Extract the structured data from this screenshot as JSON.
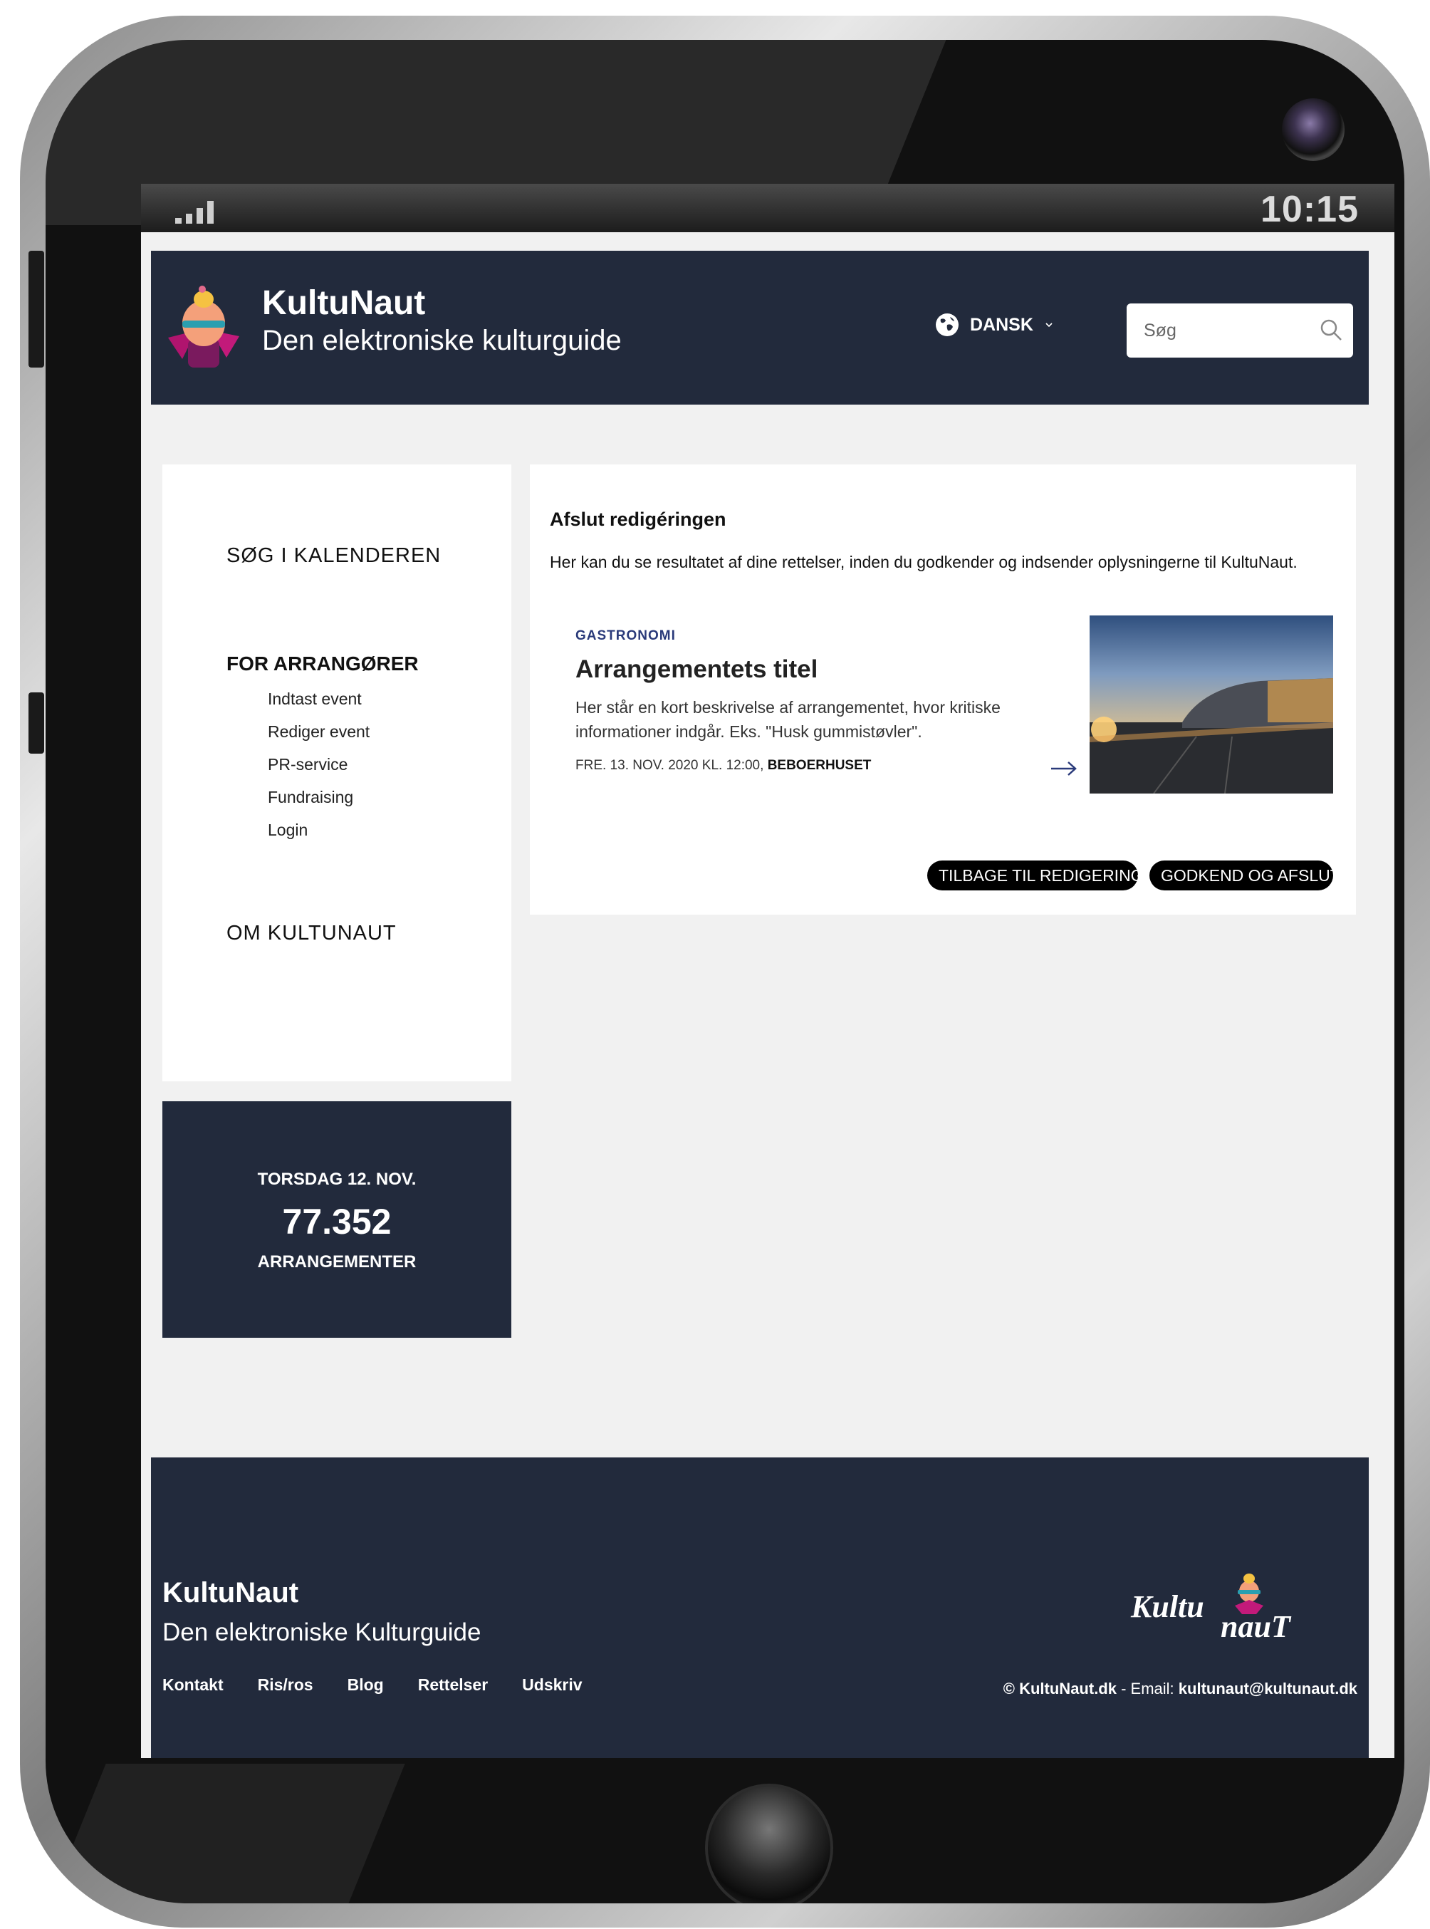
{
  "status_bar": {
    "time": "10:15"
  },
  "header": {
    "brand_name": "KultuNaut",
    "brand_tagline": "Den elektroniske kulturguide",
    "language": "DANSK",
    "search_placeholder": "Søg"
  },
  "sidebar": {
    "search_calendar": "SØG I KALENDEREN",
    "organizers_heading": "FOR ARRANGØRER",
    "organizer_items": [
      "Indtast event",
      "Rediger event",
      "PR-service",
      "Fundraising",
      "Login"
    ],
    "about": "OM KULTUNAUT"
  },
  "counter": {
    "date": "TORSDAG 12. NOV.",
    "count": "77.352",
    "label": "ARRANGEMENTER"
  },
  "main": {
    "title": "Afslut redigéringen",
    "description": "Her kan du se resultatet af dine rettelser, inden du godkender og indsender oplysningerne til KultuNaut.",
    "card": {
      "category": "GASTRONOMI",
      "title": "Arrangementets titel",
      "description": "Her står en kort beskrivelse af arrangementet, hvor kritiske informationer indgår. Eks. \"Husk gummistøvler\".",
      "datetime": "FRE. 13. NOV. 2020 KL. 12:00,",
      "venue": "BEBOERHUSET"
    },
    "back_button": "TILBAGE TIL REDIGERING",
    "approve_button": "GODKEND OG AFSLUT"
  },
  "footer": {
    "name": "KultuNaut",
    "tagline": "Den elektroniske Kulturguide",
    "links": [
      "Kontakt",
      "Ris/ros",
      "Blog",
      "Rettelser",
      "Udskriv"
    ],
    "copyright": "© KultuNaut.dk",
    "email_label": " - Email: ",
    "email": "kultunaut@kultunaut.dk",
    "logo_text": "KultuNauT"
  },
  "colors": {
    "navy": "#222a3c",
    "accent_blue": "#2a3a7a",
    "page_bg": "#f1f1f1"
  }
}
